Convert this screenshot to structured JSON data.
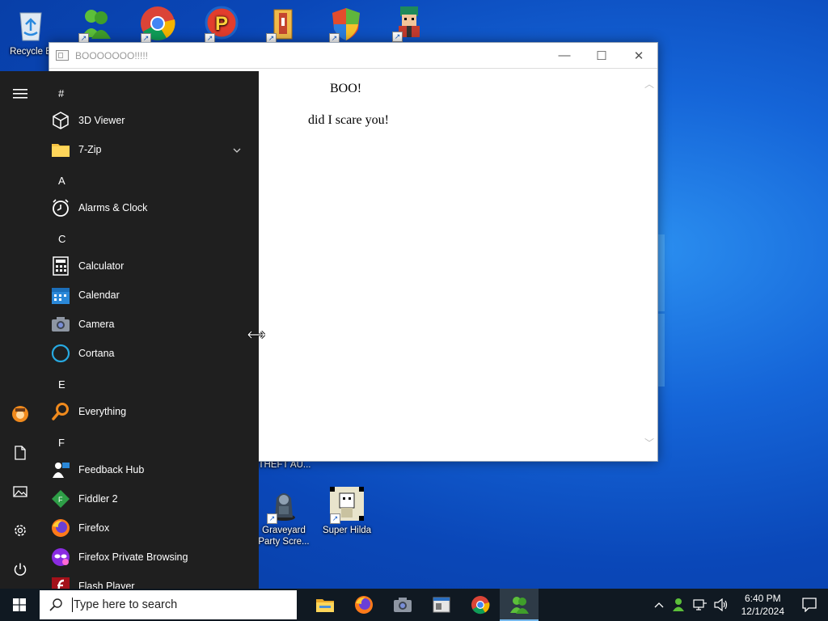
{
  "desktop": {
    "icons": [
      {
        "label": "Recycle B",
        "icon": "recycle-bin-icon"
      },
      {
        "label": "",
        "icon": "messenger-icon"
      },
      {
        "label": "",
        "icon": "chrome-icon"
      },
      {
        "label": "",
        "icon": "p-app-icon"
      },
      {
        "label": "",
        "icon": "archive-icon"
      },
      {
        "label": "",
        "icon": "shield-icon"
      },
      {
        "label": "",
        "icon": "character-icon"
      },
      {
        "label": "THEFT AU...",
        "icon": "game-icon"
      },
      {
        "label": "Graveyard Party Scre...",
        "icon": "graveyard-icon"
      },
      {
        "label": "Super Hilda",
        "icon": "super-hilda-icon"
      }
    ]
  },
  "window": {
    "title": "BOOOOOOO!!!!!",
    "controls": {
      "minimize": "—",
      "maximize": "☐",
      "close": "✕"
    },
    "heading": "BOO!",
    "message": "did I scare you!"
  },
  "start_menu": {
    "rail": [
      {
        "name": "hamburger-menu-icon"
      },
      {
        "name": "user-avatar-icon"
      },
      {
        "name": "documents-icon"
      },
      {
        "name": "pictures-icon"
      },
      {
        "name": "settings-icon"
      },
      {
        "name": "power-icon"
      }
    ],
    "groups": [
      {
        "letter": "#",
        "apps": [
          {
            "label": "3D Viewer",
            "icon": "3d-viewer-icon"
          },
          {
            "label": "7-Zip",
            "icon": "folder-icon",
            "expandable": true
          }
        ]
      },
      {
        "letter": "A",
        "apps": [
          {
            "label": "Alarms & Clock",
            "icon": "alarm-clock-icon"
          }
        ]
      },
      {
        "letter": "C",
        "apps": [
          {
            "label": "Calculator",
            "icon": "calculator-icon"
          },
          {
            "label": "Calendar",
            "icon": "calendar-icon"
          },
          {
            "label": "Camera",
            "icon": "camera-icon"
          },
          {
            "label": "Cortana",
            "icon": "cortana-icon"
          }
        ]
      },
      {
        "letter": "E",
        "apps": [
          {
            "label": "Everything",
            "icon": "search-magnifier-icon"
          }
        ]
      },
      {
        "letter": "F",
        "apps": [
          {
            "label": "Feedback Hub",
            "icon": "feedback-hub-icon"
          },
          {
            "label": "Fiddler 2",
            "icon": "fiddler-icon"
          },
          {
            "label": "Firefox",
            "icon": "firefox-icon"
          },
          {
            "label": "Firefox Private Browsing",
            "icon": "firefox-private-icon"
          },
          {
            "label": "Flash Player",
            "icon": "flash-player-icon"
          }
        ]
      }
    ]
  },
  "taskbar": {
    "search_placeholder": "Type here to search",
    "apps": [
      {
        "name": "file-explorer-icon"
      },
      {
        "name": "firefox-icon"
      },
      {
        "name": "camera-icon"
      },
      {
        "name": "window-app-icon"
      },
      {
        "name": "chrome-icon"
      },
      {
        "name": "messenger-icon",
        "active": true
      }
    ],
    "time": "6:40 PM",
    "date": "12/1/2024"
  }
}
